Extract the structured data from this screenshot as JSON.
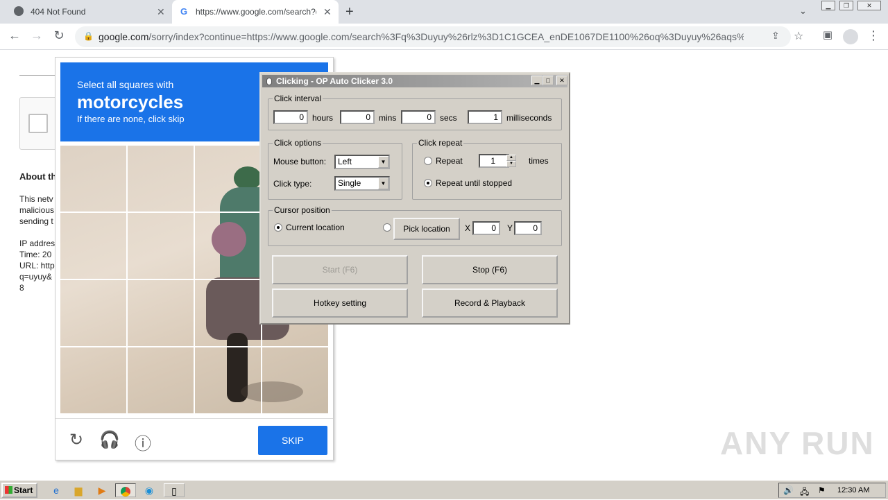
{
  "browser": {
    "tabs": [
      {
        "title": "404 Not Found",
        "icon": "globe-icon"
      },
      {
        "title": "https://www.google.com/search?q=",
        "icon": "google-icon"
      }
    ],
    "new_tab": "+",
    "tab_search": "⌄",
    "url_host": "google.com",
    "url_rest": "/sorry/index?continue=https://www.google.com/search%3Fq%3Duyuy%26rlz%3D1C1GCEA_enDE1067DE1100%26oq%3Duyuy%26aqs%..."
  },
  "page": {
    "about_heading": "About th",
    "para1": [
      "This netv",
      "malicious",
      "sending t"
    ],
    "info": [
      "IP addres",
      "Time: 20",
      "URL: http",
      "q=uyuy&",
      "8"
    ]
  },
  "captcha": {
    "line1": "Select all squares with",
    "line2": "motorcycles",
    "line3": "If there are none, click skip",
    "skip_label": "SKIP",
    "accent": "#1a73e8"
  },
  "clicker": {
    "title": "Clicking - OP Auto Clicker 3.0",
    "interval_group": "Click interval",
    "hours_value": "0",
    "hours_label": "hours",
    "mins_value": "0",
    "mins_label": "mins",
    "secs_value": "0",
    "secs_label": "secs",
    "ms_value": "1",
    "ms_label": "milliseconds",
    "options_group": "Click options",
    "mouse_button_label": "Mouse button:",
    "mouse_button_value": "Left",
    "click_type_label": "Click type:",
    "click_type_value": "Single",
    "repeat_group": "Click repeat",
    "repeat_label": "Repeat",
    "repeat_value": "1",
    "times_label": "times",
    "repeat_until_label": "Repeat until stopped",
    "cursor_group": "Cursor position",
    "current_location_label": "Current location",
    "pick_location_label": "Pick location",
    "x_label": "X",
    "x_value": "0",
    "y_label": "Y",
    "y_value": "0",
    "start_label": "Start (F6)",
    "stop_label": "Stop (F6)",
    "hotkey_label": "Hotkey setting",
    "record_label": "Record & Playback"
  },
  "watermark": "ANY RUN",
  "taskbar": {
    "start_label": "Start",
    "clock": "12:30 AM"
  }
}
